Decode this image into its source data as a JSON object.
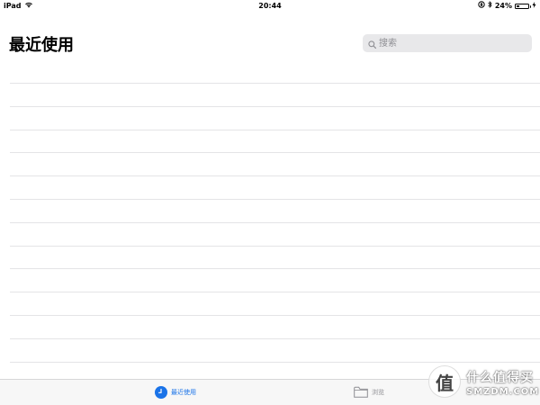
{
  "status_bar": {
    "device": "iPad",
    "time": "20:44",
    "battery": "24%",
    "battery_level": 0.24
  },
  "header": {
    "title": "最近使用"
  },
  "search": {
    "placeholder": "搜索"
  },
  "list": {
    "row_count": 13
  },
  "tab_bar": {
    "tabs": [
      {
        "label": "最近使用",
        "selected": true
      },
      {
        "label": "浏览",
        "selected": false
      }
    ]
  },
  "watermark": {
    "logo_char": "值",
    "line1": "什么值得买",
    "line2": "SMZDM.COM"
  },
  "colors": {
    "accent": "#1a73e8",
    "separator": "#e4e4e6",
    "search_bg": "#e8e8ea",
    "tab_inactive": "#8e8e93"
  }
}
